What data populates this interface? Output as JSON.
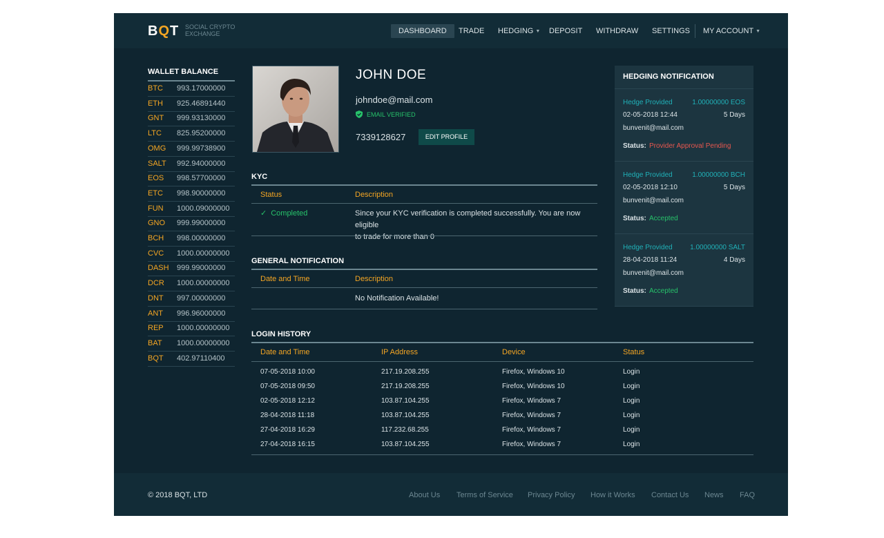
{
  "brand": {
    "logo": "BQT",
    "tagline_1": "SOCIAL CRYPTO",
    "tagline_2": "EXCHANGE"
  },
  "nav": {
    "dashboard": "DASHBOARD",
    "trade": "TRADE",
    "hedging": "HEDGING",
    "deposit": "DEPOSIT",
    "withdraw": "WITHDRAW",
    "settings": "SETTINGS",
    "my_account": "MY ACCOUNT",
    "active": "DASHBOARD"
  },
  "wallet": {
    "title": "WALLET BALANCE",
    "items": [
      {
        "symbol": "BTC",
        "balance": "993.17000000"
      },
      {
        "symbol": "ETH",
        "balance": "925.46891440"
      },
      {
        "symbol": "GNT",
        "balance": "999.93130000"
      },
      {
        "symbol": "LTC",
        "balance": "825.95200000"
      },
      {
        "symbol": "OMG",
        "balance": "999.99738900"
      },
      {
        "symbol": "SALT",
        "balance": "992.94000000"
      },
      {
        "symbol": "EOS",
        "balance": "998.57700000"
      },
      {
        "symbol": "ETC",
        "balance": "998.90000000"
      },
      {
        "symbol": "FUN",
        "balance": "1000.09000000"
      },
      {
        "symbol": "GNO",
        "balance": "999.99000000"
      },
      {
        "symbol": "BCH",
        "balance": "998.00000000"
      },
      {
        "symbol": "CVC",
        "balance": "1000.00000000"
      },
      {
        "symbol": "DASH",
        "balance": "999.99000000"
      },
      {
        "symbol": "DCR",
        "balance": "1000.00000000"
      },
      {
        "symbol": "DNT",
        "balance": "997.00000000"
      },
      {
        "symbol": "ANT",
        "balance": "996.96000000"
      },
      {
        "symbol": "REP",
        "balance": "1000.00000000"
      },
      {
        "symbol": "BAT",
        "balance": "1000.00000000"
      },
      {
        "symbol": "BQT",
        "balance": "402.97110400"
      }
    ]
  },
  "profile": {
    "name": "JOHN DOE",
    "email": "johndoe@mail.com",
    "email_status": "EMAIL VERIFIED",
    "phone": "7339128627",
    "edit_label": "EDIT PROFILE"
  },
  "kyc": {
    "title": "KYC",
    "headers": {
      "status": "Status",
      "description": "Description"
    },
    "row": {
      "status": "Completed",
      "description_line1": "Since your KYC verification is completed successfully. You are now eligible",
      "description_line2": "to trade for more than 0"
    }
  },
  "general_notification": {
    "title": "GENERAL NOTIFICATION",
    "headers": {
      "date": "Date and Time",
      "description": "Description"
    },
    "empty_text": "No Notification Available!"
  },
  "login_history": {
    "title": "LOGIN HISTORY",
    "headers": {
      "date": "Date and Time",
      "ip": "IP Address",
      "device": "Device",
      "status": "Status"
    },
    "rows": [
      {
        "date": "07-05-2018 10:00",
        "ip": "217.19.208.255",
        "device": "Firefox, Windows 10",
        "status": "Login"
      },
      {
        "date": "07-05-2018 09:50",
        "ip": "217.19.208.255",
        "device": "Firefox, Windows 10",
        "status": "Login"
      },
      {
        "date": "02-05-2018 12:12",
        "ip": "103.87.104.255",
        "device": "Firefox, Windows 7",
        "status": "Login"
      },
      {
        "date": "28-04-2018 11:18",
        "ip": "103.87.104.255",
        "device": "Firefox, Windows 7",
        "status": "Login"
      },
      {
        "date": "27-04-2018 16:29",
        "ip": "117.232.68.255",
        "device": "Firefox, Windows 7",
        "status": "Login"
      },
      {
        "date": "27-04-2018 16:15",
        "ip": "103.87.104.255",
        "device": "Firefox, Windows 7",
        "status": "Login"
      }
    ]
  },
  "hedging": {
    "title": "HEDGING NOTIFICATION",
    "status_label": "Status:",
    "items": [
      {
        "label": "Hedge Provided",
        "amount": "1.00000000 EOS",
        "date": "02-05-2018 12:44",
        "duration": "5 Days",
        "email": "bunvenit@mail.com",
        "status": "Provider Approval Pending",
        "status_color": "#e8574f"
      },
      {
        "label": "Hedge Provided",
        "amount": "1.00000000 BCH",
        "date": "02-05-2018 12:10",
        "duration": "5 Days",
        "email": "bunvenit@mail.com",
        "status": "Accepted",
        "status_color": "#27c26a"
      },
      {
        "label": "Hedge Provided",
        "amount": "1.00000000 SALT",
        "date": "28-04-2018 11:24",
        "duration": "4 Days",
        "email": "bunvenit@mail.com",
        "status": "Accepted",
        "status_color": "#27c26a"
      }
    ]
  },
  "footer": {
    "copyright": "© 2018 BQT, LTD",
    "links": {
      "about": "About Us",
      "terms": "Terms of Service",
      "privacy": "Privacy Policy",
      "how": "How it Works",
      "contact": "Contact Us",
      "news": "News",
      "faq": "FAQ"
    }
  },
  "colors": {
    "background": "#0f2530",
    "accent": "#f5a623",
    "teal": "#20b1b8",
    "success": "#27c26a",
    "danger": "#e8574f"
  }
}
